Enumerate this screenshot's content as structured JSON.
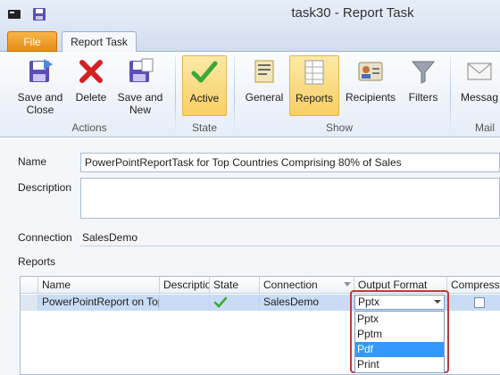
{
  "window": {
    "title": "task30 - Report Task"
  },
  "tabs": {
    "file": "File",
    "report_task": "Report Task"
  },
  "ribbon": {
    "save_close": "Save and\nClose",
    "delete": "Delete",
    "save_new": "Save and\nNew",
    "active": "Active",
    "general": "General",
    "reports": "Reports",
    "recipients": "Recipients",
    "filters": "Filters",
    "messages": "Messag",
    "groups": {
      "actions": "Actions",
      "state": "State",
      "show": "Show",
      "mail": "Mail"
    }
  },
  "form": {
    "name_label": "Name",
    "name_value": "PowerPointReportTask for Top Countries Comprising 80% of Sales",
    "description_label": "Description",
    "description_value": "",
    "connection_label": "Connection",
    "connection_value": "SalesDemo",
    "reports_label": "Reports"
  },
  "grid": {
    "columns": [
      "Name",
      "Descriptio",
      "State",
      "Connection",
      "Output Format",
      "Compress"
    ],
    "row": {
      "name": "PowerPointReport on Top",
      "description": "",
      "connection": "SalesDemo",
      "output_format": "Pptx"
    }
  },
  "dropdown": {
    "selected": "Pptx",
    "options": [
      "Pptx",
      "Pptm",
      "Pdf",
      "Print"
    ],
    "highlighted": "Pdf"
  }
}
